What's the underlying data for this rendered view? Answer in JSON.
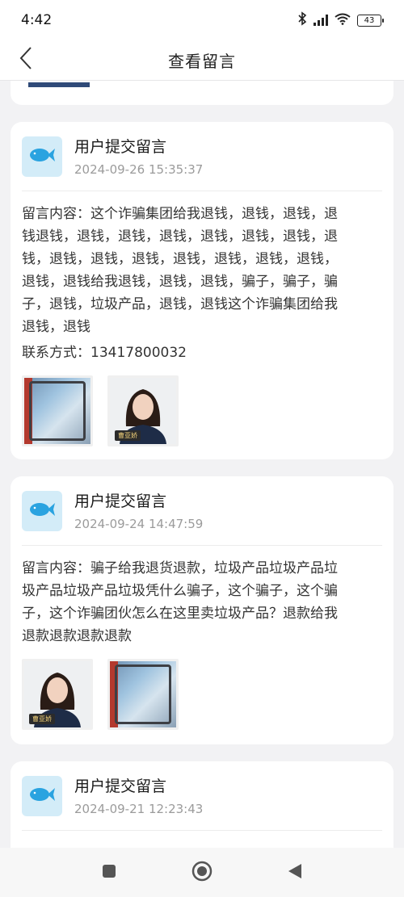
{
  "status_bar": {
    "time": "4:42",
    "battery": "43",
    "icons": [
      "bluetooth-icon",
      "signal-icon",
      "wifi-icon",
      "battery-icon"
    ]
  },
  "header": {
    "title": "查看留言",
    "back_icon": "chevron-left-icon"
  },
  "messages": [
    {
      "title": "用户提交留言",
      "time": "2024-09-26 15:35:37",
      "content_lines": [
        "留言内容：这个诈骗集团给我退钱，退钱，退钱，退",
        "钱退钱，退钱，退钱，退钱，退钱，退钱，退钱，退",
        "钱，退钱，退钱，退钱，退钱，退钱，退钱，退钱，",
        "退钱，退钱给我退钱，退钱，退钱，骗子，骗子，骗",
        "子，退钱，垃圾产品，退钱，退钱这个诈骗集团给我",
        "退钱，退钱"
      ],
      "contact": "联系方式：13417800032",
      "images": [
        "screen-photo",
        "portrait-photo"
      ]
    },
    {
      "title": "用户提交留言",
      "time": "2024-09-24 14:47:59",
      "content_lines": [
        "留言内容：骗子给我退货退款，垃圾产品垃圾产品垃",
        "圾产品垃圾产品垃圾凭什么骗子，这个骗子，这个骗",
        "子，这个诈骗团伙怎么在这里卖垃圾产品？退款给我",
        "退款退款退款退款"
      ],
      "images": [
        "portrait-photo",
        "screen-photo"
      ]
    },
    {
      "title": "用户提交留言",
      "time": "2024-09-21 12:23:43"
    }
  ],
  "portrait_badge": "曹亚娇",
  "colors": {
    "accent_fish": "#2aa3e0",
    "fish_bg": "#d3ecf8",
    "background": "#f2f2f4"
  },
  "nav_bar": {
    "icons": [
      "square-recents-icon",
      "circle-home-icon",
      "triangle-back-icon"
    ]
  }
}
